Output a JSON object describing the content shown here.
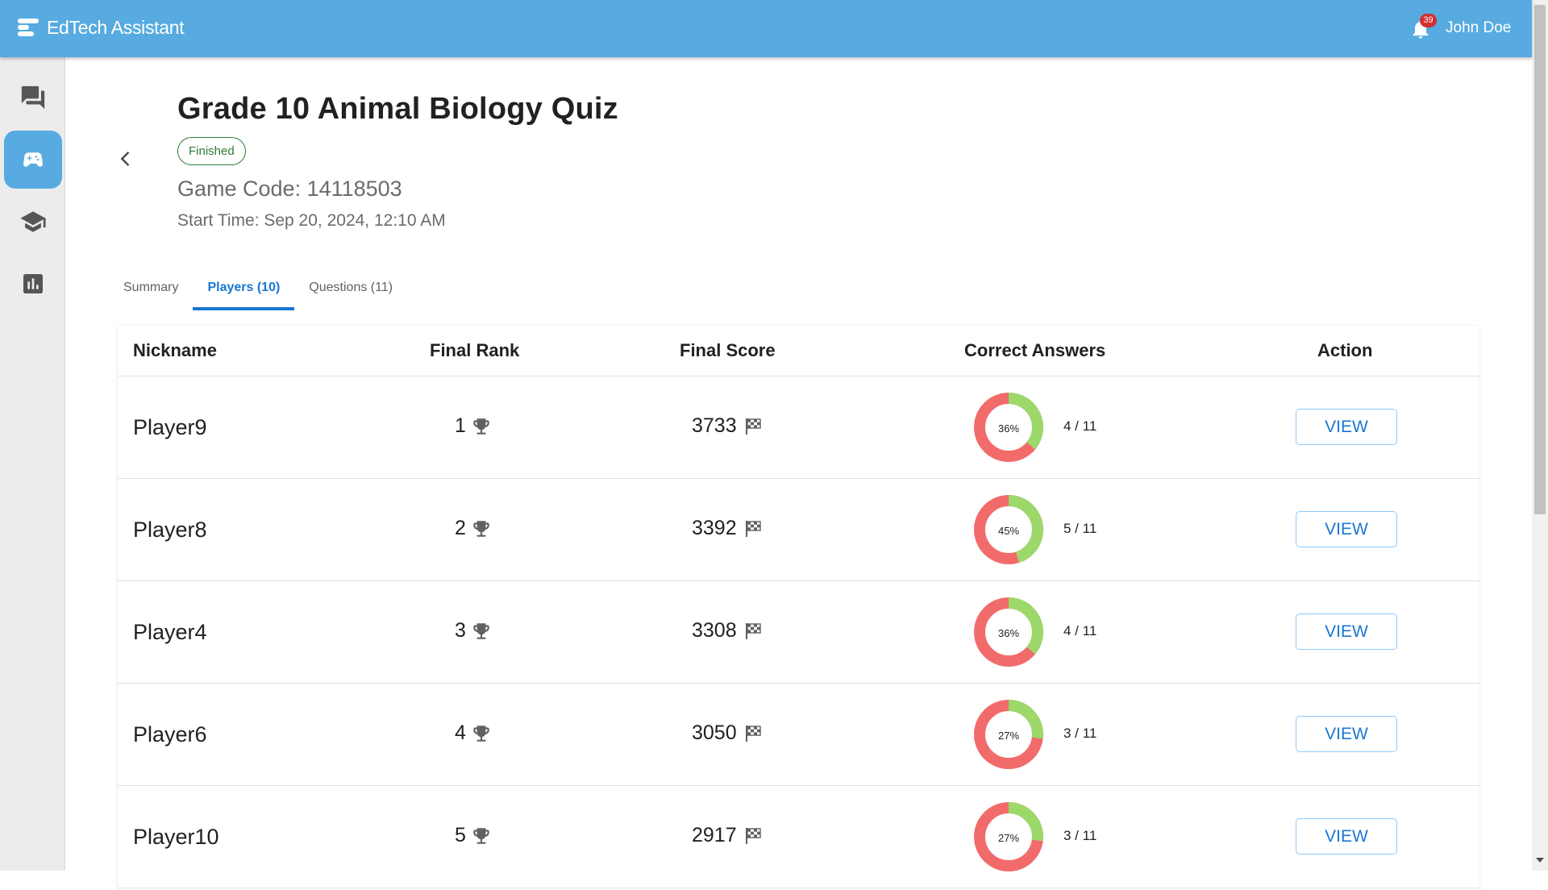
{
  "app": {
    "name": "EdTech Assistant"
  },
  "header": {
    "notification_count": "39",
    "user_name": "John Doe"
  },
  "sidebar": {
    "items": [
      {
        "icon": "chat-icon",
        "active": false
      },
      {
        "icon": "gamepad-icon",
        "active": true
      },
      {
        "icon": "graduation-cap-icon",
        "active": false
      },
      {
        "icon": "bar-chart-icon",
        "active": false
      }
    ]
  },
  "quiz": {
    "title": "Grade 10 Animal Biology Quiz",
    "status": "Finished",
    "game_code": "Game Code: 14118503",
    "start_time": "Start Time: Sep 20, 2024, 12:10 AM"
  },
  "tabs": [
    {
      "label": "Summary",
      "active": false
    },
    {
      "label": "Players (10)",
      "active": true
    },
    {
      "label": "Questions (11)",
      "active": false
    }
  ],
  "table": {
    "headers": {
      "nickname": "Nickname",
      "rank": "Final Rank",
      "score": "Final Score",
      "correct": "Correct Answers",
      "action": "Action"
    },
    "rows": [
      {
        "nickname": "Player9",
        "rank": "1",
        "score": "3733",
        "percent": "36%",
        "correct_fraction": 0.36,
        "ratio": "4 / 11",
        "action": "VIEW"
      },
      {
        "nickname": "Player8",
        "rank": "2",
        "score": "3392",
        "percent": "45%",
        "correct_fraction": 0.45,
        "ratio": "5 / 11",
        "action": "VIEW"
      },
      {
        "nickname": "Player4",
        "rank": "3",
        "score": "3308",
        "percent": "36%",
        "correct_fraction": 0.36,
        "ratio": "4 / 11",
        "action": "VIEW"
      },
      {
        "nickname": "Player6",
        "rank": "4",
        "score": "3050",
        "percent": "27%",
        "correct_fraction": 0.27,
        "ratio": "3 / 11",
        "action": "VIEW"
      },
      {
        "nickname": "Player10",
        "rank": "5",
        "score": "2917",
        "percent": "27%",
        "correct_fraction": 0.27,
        "ratio": "3 / 11",
        "action": "VIEW"
      }
    ]
  },
  "colors": {
    "header_bg": "#57abe0",
    "correct": "#9cd86a",
    "incorrect": "#f26b6b",
    "accent": "#1976d2",
    "finished": "#2e7d32"
  }
}
